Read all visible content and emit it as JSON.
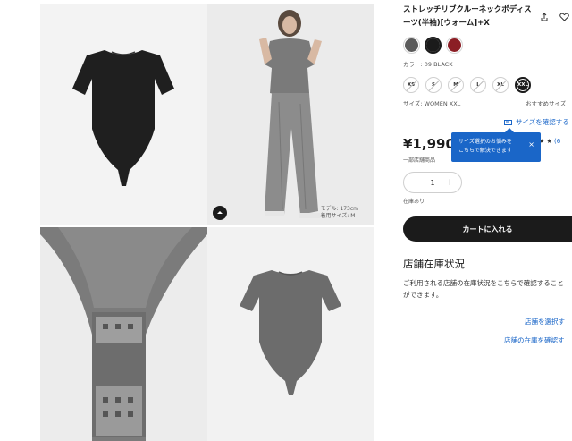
{
  "product": {
    "title": "ストレッチリブクルーネックボディスーツ(半袖)[ウォーム]+X",
    "color_label": "カラー: 09 BLACK",
    "colors": [
      {
        "name": "gray",
        "hex": "#5b5b5b",
        "selected": false
      },
      {
        "name": "black",
        "hex": "#1b1b1b",
        "selected": true
      },
      {
        "name": "red",
        "hex": "#8b1e25",
        "selected": false
      }
    ],
    "sizes": [
      {
        "label": "XS",
        "available": false
      },
      {
        "label": "S",
        "available": false
      },
      {
        "label": "M",
        "available": false
      },
      {
        "label": "L",
        "available": false
      },
      {
        "label": "XL",
        "available": false
      },
      {
        "label": "XXL",
        "available": true,
        "selected": true
      }
    ],
    "size_label": "サイズ: WOMEN XXL",
    "recommend_label": "おすすめサイズ",
    "size_check_link": "サイズを確認する",
    "price": "¥1,990",
    "price_note": "一部店舗商品",
    "rating_stars": "★ ★",
    "rating_count": "(6",
    "quantity": "1",
    "qty_minus": "−",
    "qty_plus": "+",
    "stock": "在庫あり",
    "cart_button": "カートに入れる"
  },
  "tooltip": {
    "line1": "サイズ選択のお悩みを",
    "line2": "こちらで解決できます",
    "close": "×"
  },
  "store": {
    "heading": "店舗在庫状況",
    "desc_line1": "ご利用される店舗の在庫状況をこちらで確認すること",
    "desc_line2": "ができます。",
    "select_link": "店舗を選択す",
    "check_link": "店舗の在庫を確認す"
  },
  "gallery": {
    "model_info_line1": "モデル: 173cm",
    "model_info_line2": "着用サイズ: M"
  }
}
